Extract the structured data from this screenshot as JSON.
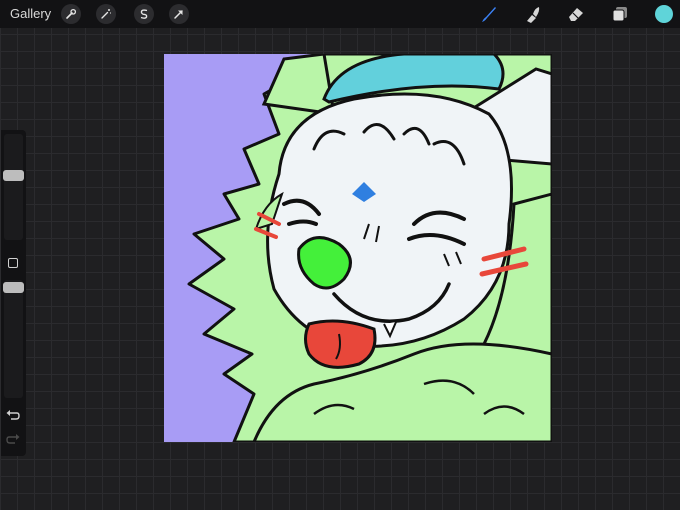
{
  "toolbar": {
    "gallery_label": "Gallery",
    "left_tools": [
      {
        "name": "actions",
        "icon": "wrench-icon"
      },
      {
        "name": "adjustments",
        "icon": "magic-wand-icon"
      },
      {
        "name": "selection",
        "icon": "selection-s-icon"
      },
      {
        "name": "transform",
        "icon": "arrow-cursor-icon"
      }
    ],
    "right_tools": [
      {
        "name": "brush",
        "icon": "brush-icon",
        "active": true
      },
      {
        "name": "smudge",
        "icon": "smudge-icon",
        "active": false
      },
      {
        "name": "eraser",
        "icon": "eraser-icon",
        "active": false
      },
      {
        "name": "layers",
        "icon": "layers-icon",
        "active": false
      }
    ],
    "current_color": "#5fd4d9",
    "active_tool_color": "#3b82f6"
  },
  "sidebar": {
    "brush_size_level": 0.62,
    "opacity_level": 0.98,
    "modifier_icon": "square-icon",
    "undo_icon": "undo-arrow-icon",
    "redo_icon": "redo-arrow-icon"
  },
  "artwork": {
    "background_color": "#a89cf5",
    "fur_color": "#b9f5a8",
    "face_color": "#f0f4f7",
    "hat_color": "#62d0dc",
    "nose_color": "#44f03a",
    "tongue_color": "#e8473a",
    "marking_color": "#e8473a",
    "gem_color": "#2f7fe0"
  }
}
